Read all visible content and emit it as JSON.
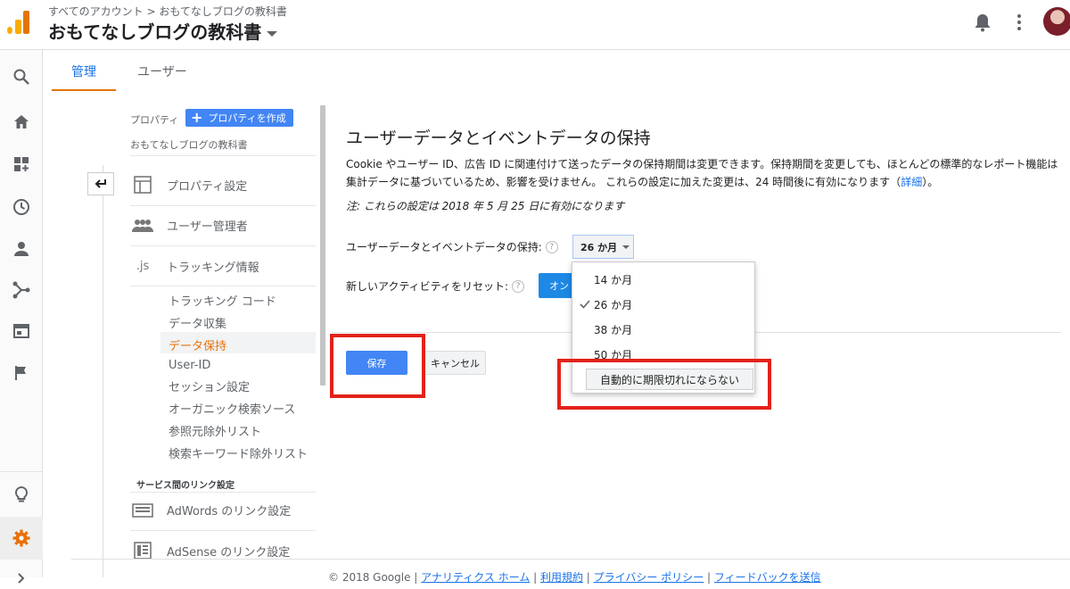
{
  "header": {
    "breadcrumb": "すべてのアカウント > おもてなしブログの教科書",
    "account_title": "おもてなしブログの教科書"
  },
  "tabs": {
    "admin": "管理",
    "user": "ユーザー"
  },
  "sidebar": {
    "property_label": "プロパティ",
    "create_property": "プロパティを作成",
    "property_name": "おもてなしブログの教科書",
    "items": [
      {
        "label": "プロパティ設定",
        "icon": "property-settings-icon"
      },
      {
        "label": "ユーザー管理者",
        "icon": "users-icon"
      },
      {
        "label": "トラッキング情報",
        "icon": "js-icon",
        "icon_text": ".js"
      }
    ],
    "sub_items": [
      "トラッキング コード",
      "データ収集",
      "データ保持",
      "User-ID",
      "セッション設定",
      "オーガニック検索ソース",
      "参照元除外リスト",
      "検索キーワード除外リスト"
    ],
    "active_sub_item": "データ保持",
    "link_section_title": "サービス間のリンク設定",
    "link_items": [
      {
        "label": "AdWords のリンク設定",
        "icon": "adwords-icon"
      },
      {
        "label": "AdSense のリンク設定",
        "icon": "adsense-icon"
      }
    ]
  },
  "main": {
    "title": "ユーザーデータとイベントデータの保持",
    "description": "Cookie やユーザー ID、広告 ID に関連付けて送ったデータの保持期間は変更できます。保持期間を変更しても、ほとんどの標準的なレポート機能は集計データに基づいているため、影響を受けません。 これらの設定に加えた変更は、24 時間後に有効になります（",
    "details_link": "詳細",
    "description_end": "）。",
    "note": "注: これらの設定は 2018 年 5 月 25 日に有効になります",
    "retention_label": "ユーザーデータとイベントデータの保持:",
    "retention_value": "26 か月",
    "reset_label": "新しいアクティビティをリセット:",
    "reset_button": "オン",
    "save_button": "保存",
    "cancel_button": "キャンセル"
  },
  "dropdown": {
    "options": [
      "14 か月",
      "26 か月",
      "38 か月",
      "50 か月",
      "自動的に期限切れにならない"
    ],
    "selected": "26 か月"
  },
  "footer": {
    "copyright": "© 2018 Google",
    "links": [
      "アナリティクス ホーム",
      "利用規約",
      "プライバシー ポリシー",
      "フィードバックを送信"
    ]
  },
  "colors": {
    "accent_blue": "#4285f4",
    "tab_orange": "#e37400",
    "active_item": "#e8710a",
    "highlight_red": "#e3221a"
  }
}
